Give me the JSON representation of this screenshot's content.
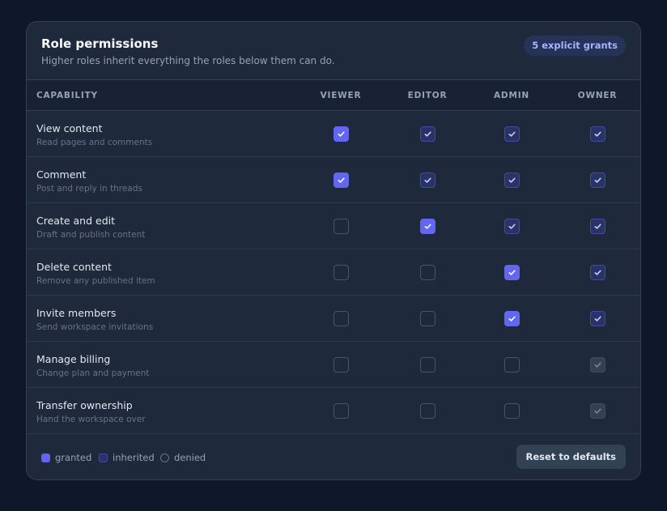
{
  "header": {
    "title": "Role permissions",
    "subtitle": "Higher roles inherit everything the roles below them can do.",
    "badge": "5 explicit grants"
  },
  "columns": {
    "capability": "Capability",
    "roles": [
      "Viewer",
      "Editor",
      "Admin",
      "Owner"
    ]
  },
  "rows": [
    {
      "name": "View content",
      "desc": "Read pages and comments",
      "cells": [
        "granted",
        "inherited",
        "inherited",
        "inherited"
      ]
    },
    {
      "name": "Comment",
      "desc": "Post and reply in threads",
      "cells": [
        "granted",
        "inherited",
        "inherited",
        "inherited"
      ]
    },
    {
      "name": "Create and edit",
      "desc": "Draft and publish content",
      "cells": [
        "denied",
        "granted",
        "inherited",
        "inherited"
      ]
    },
    {
      "name": "Delete content",
      "desc": "Remove any published item",
      "cells": [
        "denied",
        "denied",
        "granted",
        "inherited"
      ]
    },
    {
      "name": "Invite members",
      "desc": "Send workspace invitations",
      "cells": [
        "denied",
        "denied",
        "granted",
        "inherited"
      ]
    },
    {
      "name": "Manage billing",
      "desc": "Change plan and payment",
      "cells": [
        "denied",
        "denied",
        "denied",
        "locked"
      ]
    },
    {
      "name": "Transfer ownership",
      "desc": "Hand the workspace over",
      "cells": [
        "denied",
        "denied",
        "denied",
        "locked"
      ]
    }
  ],
  "legend": {
    "granted": "granted",
    "inherited": "inherited",
    "denied": "denied"
  },
  "footer": {
    "reset_label": "Reset to defaults"
  },
  "colors": {
    "accent": "#6366f1",
    "inherited": "#2a3366",
    "background": "#0f172a",
    "card": "#1e293b"
  },
  "icons": {
    "check": "check-icon"
  }
}
